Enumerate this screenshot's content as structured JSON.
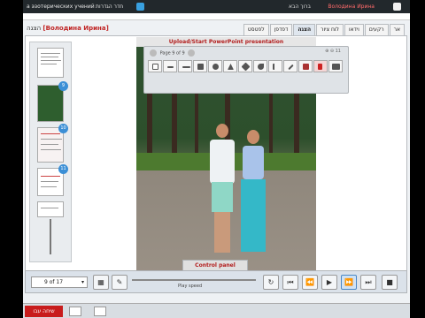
{
  "topbar": {
    "left_text": "а эзотерических учений",
    "rooms": "חדר הגדרות",
    "welcome": "ברוך הבא",
    "user": "Володина Ирина"
  },
  "presenter": {
    "label": "הצגה",
    "name": "[Володина Ирина]"
  },
  "tabs": [
    "אר",
    "רקעים",
    "וידאו",
    "לוח ציור",
    "הצגה",
    "דפדפן",
    "לפטסט"
  ],
  "active_tab": "הצגה",
  "panel": {
    "title": "Upload/Start PowerPoint presentation",
    "page_info": "Page 9 of 9",
    "zoom": "11"
  },
  "thumbnails": [
    {
      "index": "",
      "kind": "doc"
    },
    {
      "index": "9",
      "kind": "photo"
    },
    {
      "index": "10",
      "kind": "text"
    },
    {
      "index": "11",
      "kind": "text"
    },
    {
      "index": "",
      "kind": "text"
    }
  ],
  "tools": [
    "select-icon",
    "pen-icon",
    "brush-icon",
    "square-icon",
    "circle-icon",
    "triangle-icon",
    "diamond-icon",
    "arrow-icon",
    "text-icon",
    "pencil-icon",
    "eraser-icon",
    "pointer-icon",
    "screen-icon"
  ],
  "control": {
    "label": "Control panel",
    "page_select": "9 of 17",
    "speed": "Play speed"
  },
  "bottom": {
    "chat": "שיחה עבו"
  }
}
